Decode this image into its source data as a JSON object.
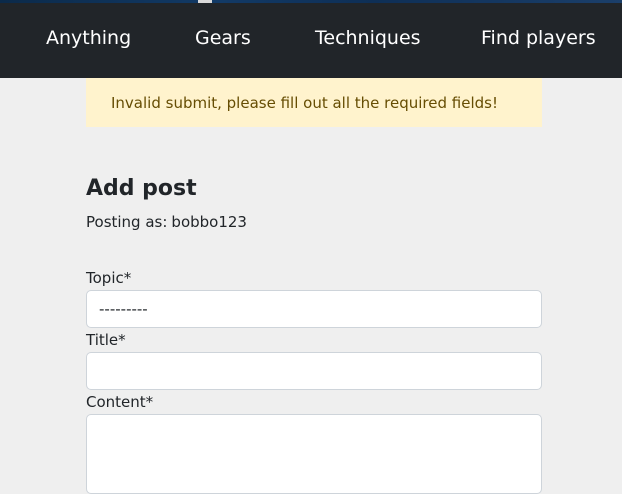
{
  "nav": {
    "items": [
      {
        "label": "Anything"
      },
      {
        "label": "Gears"
      },
      {
        "label": "Techniques"
      },
      {
        "label": "Find players"
      }
    ]
  },
  "alert": {
    "message": "Invalid submit, please fill out all the required fields!"
  },
  "form": {
    "title": "Add post",
    "posting_as_label": "Posting as:",
    "username": "bobbo123",
    "topic": {
      "label": "Topic*",
      "selected": "---------"
    },
    "title_field": {
      "label": "Title*",
      "value": ""
    },
    "content_field": {
      "label": "Content*",
      "value": ""
    }
  },
  "colors": {
    "navbar": "#212529",
    "alert_bg": "#fff3cd",
    "page_bg": "#efefef"
  }
}
